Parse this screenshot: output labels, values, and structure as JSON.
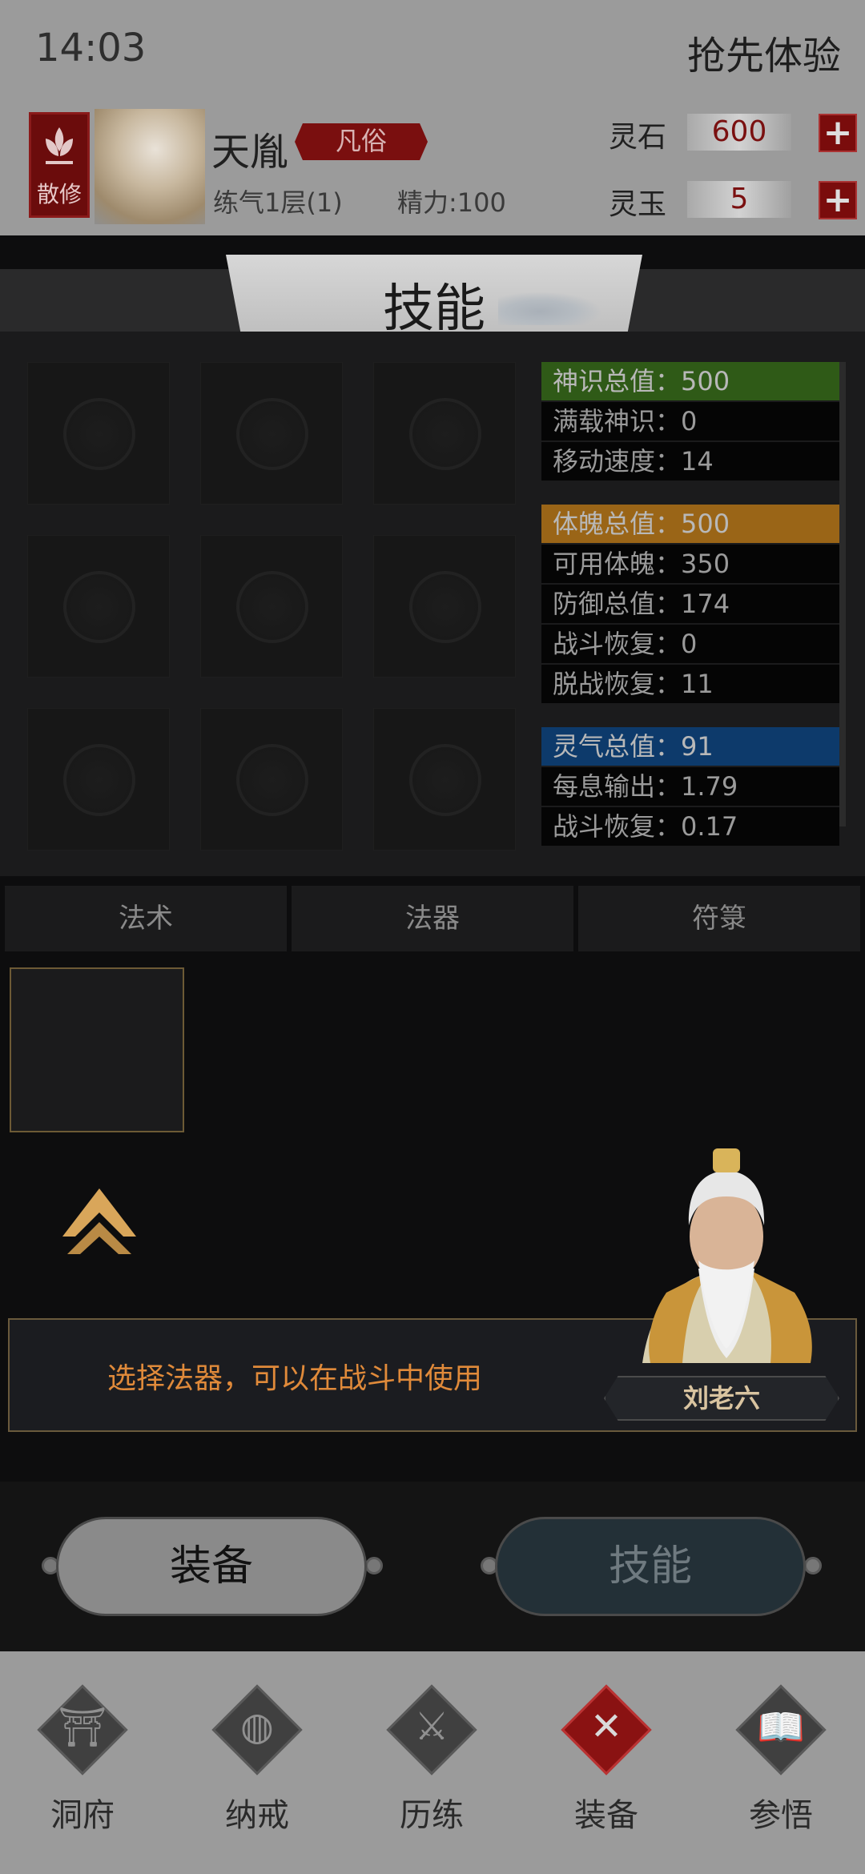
{
  "status_bar": {
    "time": "14:03",
    "early_access": "抢先体验"
  },
  "player": {
    "sect_badge": "散修",
    "name": "天胤",
    "rank": "凡俗",
    "level": "练气1层(1)",
    "energy": "精力:100"
  },
  "currencies": [
    {
      "label": "灵石",
      "value": "600"
    },
    {
      "label": "灵玉",
      "value": "5"
    }
  ],
  "page_title": "技能",
  "stats": {
    "groups": [
      {
        "header": "神识总值：500",
        "color": "#2f5a17",
        "rows": [
          "满载神识：0",
          "移动速度：14"
        ]
      },
      {
        "header": "体魄总值：500",
        "color": "#9a6517",
        "rows": [
          "可用体魄：350",
          "防御总值：174",
          "战斗恢复：0",
          "脱战恢复：11"
        ]
      },
      {
        "header": "灵气总值：91",
        "color": "#0d3a6b",
        "rows": [
          "每息输出：1.79",
          "战斗恢复：0.17"
        ]
      }
    ]
  },
  "tabs": [
    "法术",
    "法器",
    "符箓"
  ],
  "active_tab": 0,
  "dialog": {
    "message": "选择法器，可以在战斗中使用",
    "npc_name": "刘老六"
  },
  "buttons": {
    "equip": "装备",
    "skill": "技能"
  },
  "nav": {
    "items": [
      {
        "label": "洞府",
        "icon": "cave-mansion-icon",
        "glyph": "⛩"
      },
      {
        "label": "纳戒",
        "icon": "ring-icon",
        "glyph": "◍"
      },
      {
        "label": "历练",
        "icon": "crossed-swords-icon",
        "glyph": "⚔"
      },
      {
        "label": "装备",
        "icon": "close-icon",
        "glyph": "✕"
      },
      {
        "label": "参悟",
        "icon": "open-book-icon",
        "glyph": "📖"
      }
    ],
    "active_index": 3
  }
}
